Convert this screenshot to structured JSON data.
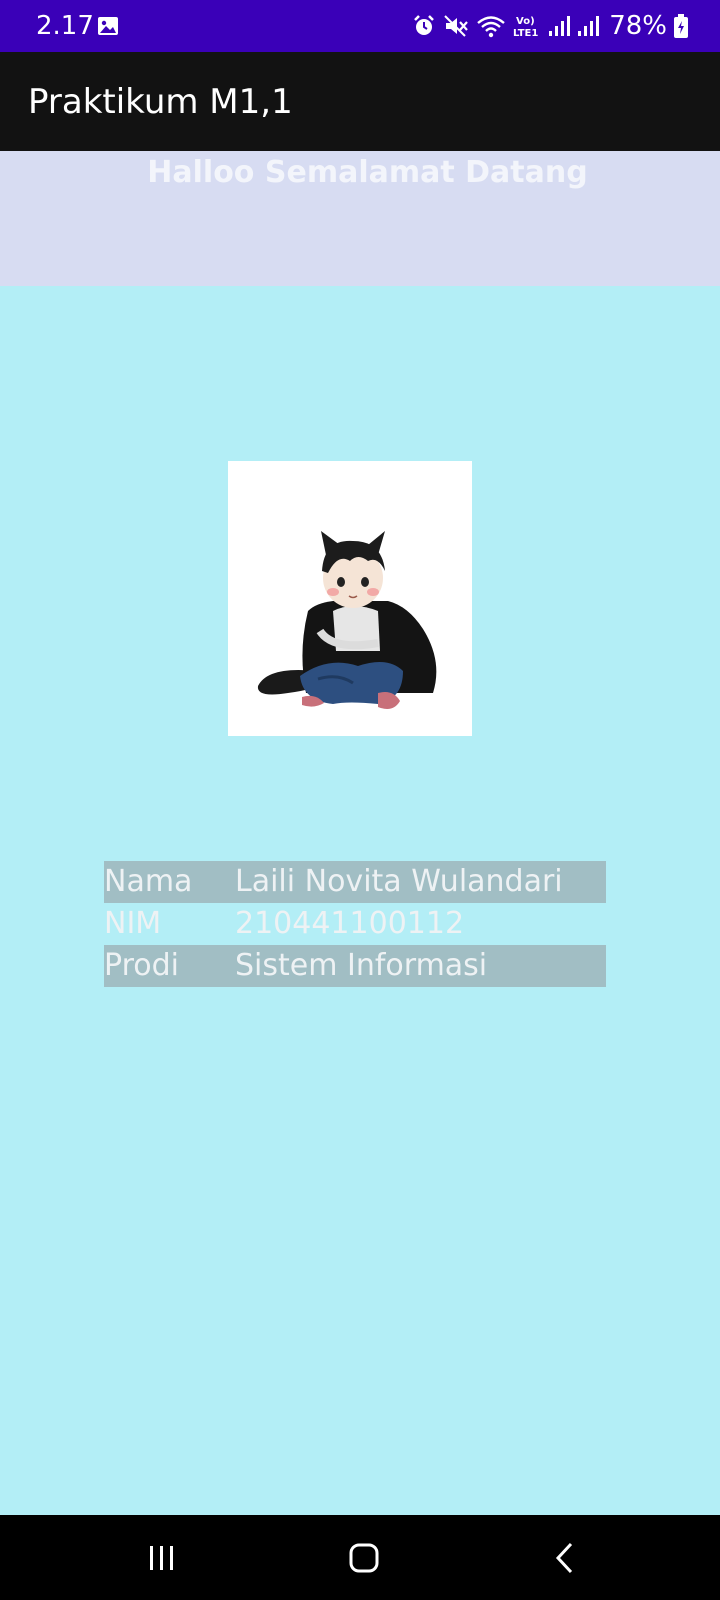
{
  "status_bar": {
    "time": "2.17",
    "battery": "78%",
    "icons": [
      "gallery-icon",
      "alarm-icon",
      "mute-icon",
      "wifi-icon",
      "volte-icon",
      "signal-icon",
      "signal-icon",
      "battery-icon"
    ],
    "volte_label": "Vo) LTE1"
  },
  "app_bar": {
    "title": "Praktikum M1,1"
  },
  "welcome": {
    "text": "Halloo Semalamat Datang"
  },
  "profile": {
    "image_icon": "chibi-character-image"
  },
  "info": {
    "rows": [
      {
        "label": "Nama",
        "value": "Laili Novita Wulandari"
      },
      {
        "label": "NIM",
        "value": "210441100112"
      },
      {
        "label": "Prodi",
        "value": "Sistem Informasi"
      }
    ]
  },
  "nav_bar": {
    "buttons": [
      "recent-apps-icon",
      "home-icon",
      "back-icon"
    ]
  },
  "colors": {
    "status_bar": "#3a00b8",
    "app_bar": "#121212",
    "banner": "#d7dcf2",
    "background": "#b3eef6",
    "row_shade": "#a1bec4"
  }
}
